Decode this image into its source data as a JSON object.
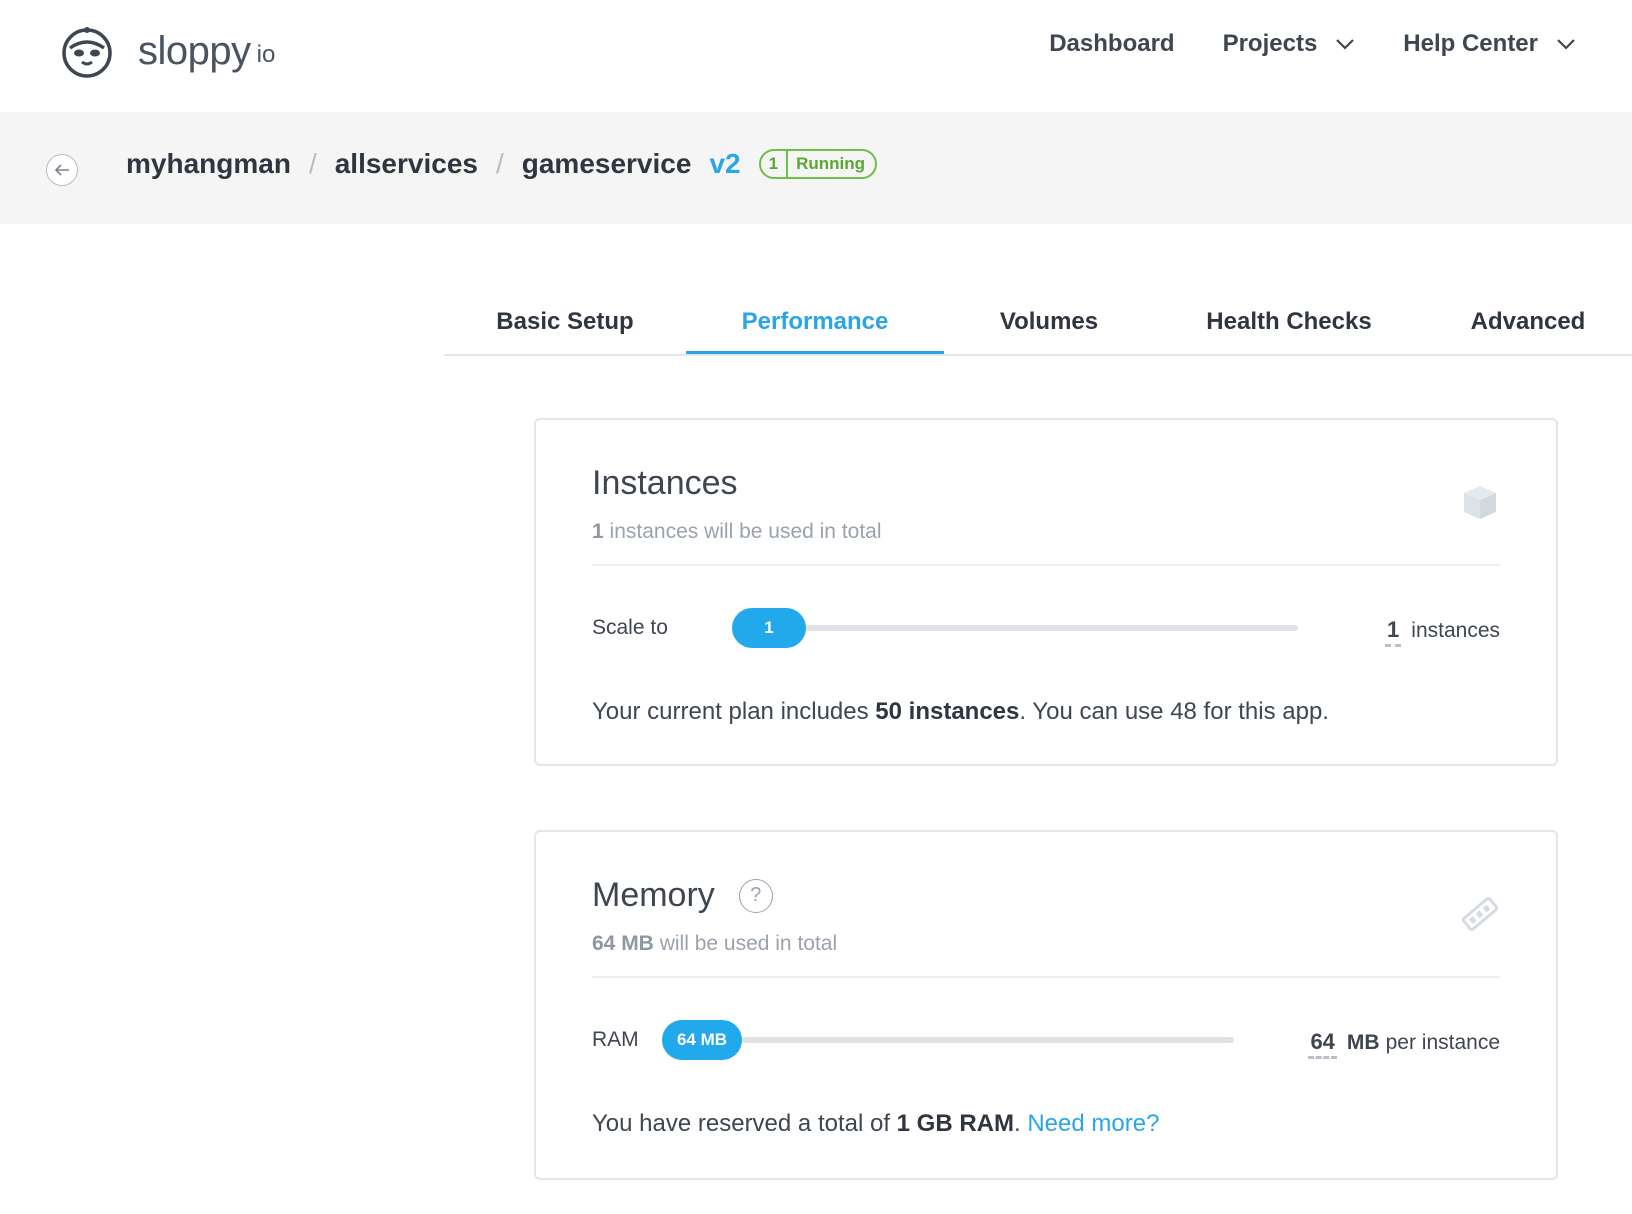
{
  "brand": {
    "name": "sloppy",
    "suffix": "io"
  },
  "nav": {
    "dashboard": "Dashboard",
    "projects": "Projects",
    "help": "Help Center"
  },
  "breadcrumb": {
    "project": "myhangman",
    "service_group": "allservices",
    "app": "gameservice",
    "version": "v2",
    "status_count": "1",
    "status_text": "Running",
    "separator": "/"
  },
  "tabs": [
    "Basic Setup",
    "Performance",
    "Volumes",
    "Health Checks",
    "Advanced"
  ],
  "active_tab": "Performance",
  "instances": {
    "title": "Instances",
    "sub_value": "1",
    "sub_text": "instances will be used in total",
    "label": "Scale to",
    "slider_value": "1",
    "value": "1",
    "unit": "instances",
    "note_prefix": "Your current plan includes ",
    "note_bold": "50 instances",
    "note_suffix": ". You can use 48 for this app."
  },
  "memory": {
    "title": "Memory",
    "help": "?",
    "sub_value": "64 MB",
    "sub_text": "will be used in total",
    "label": "RAM",
    "slider_value": "64 MB",
    "value": "64",
    "unit_bold": "MB",
    "unit": "per instance",
    "note_prefix": "You have reserved a total of ",
    "note_bold": "1 GB RAM",
    "note_suffix": ".",
    "link": "Need more?"
  },
  "colors": {
    "accent": "#2aa6e6",
    "running": "#6fbe45",
    "slider_thumb": "#22a9ec"
  }
}
